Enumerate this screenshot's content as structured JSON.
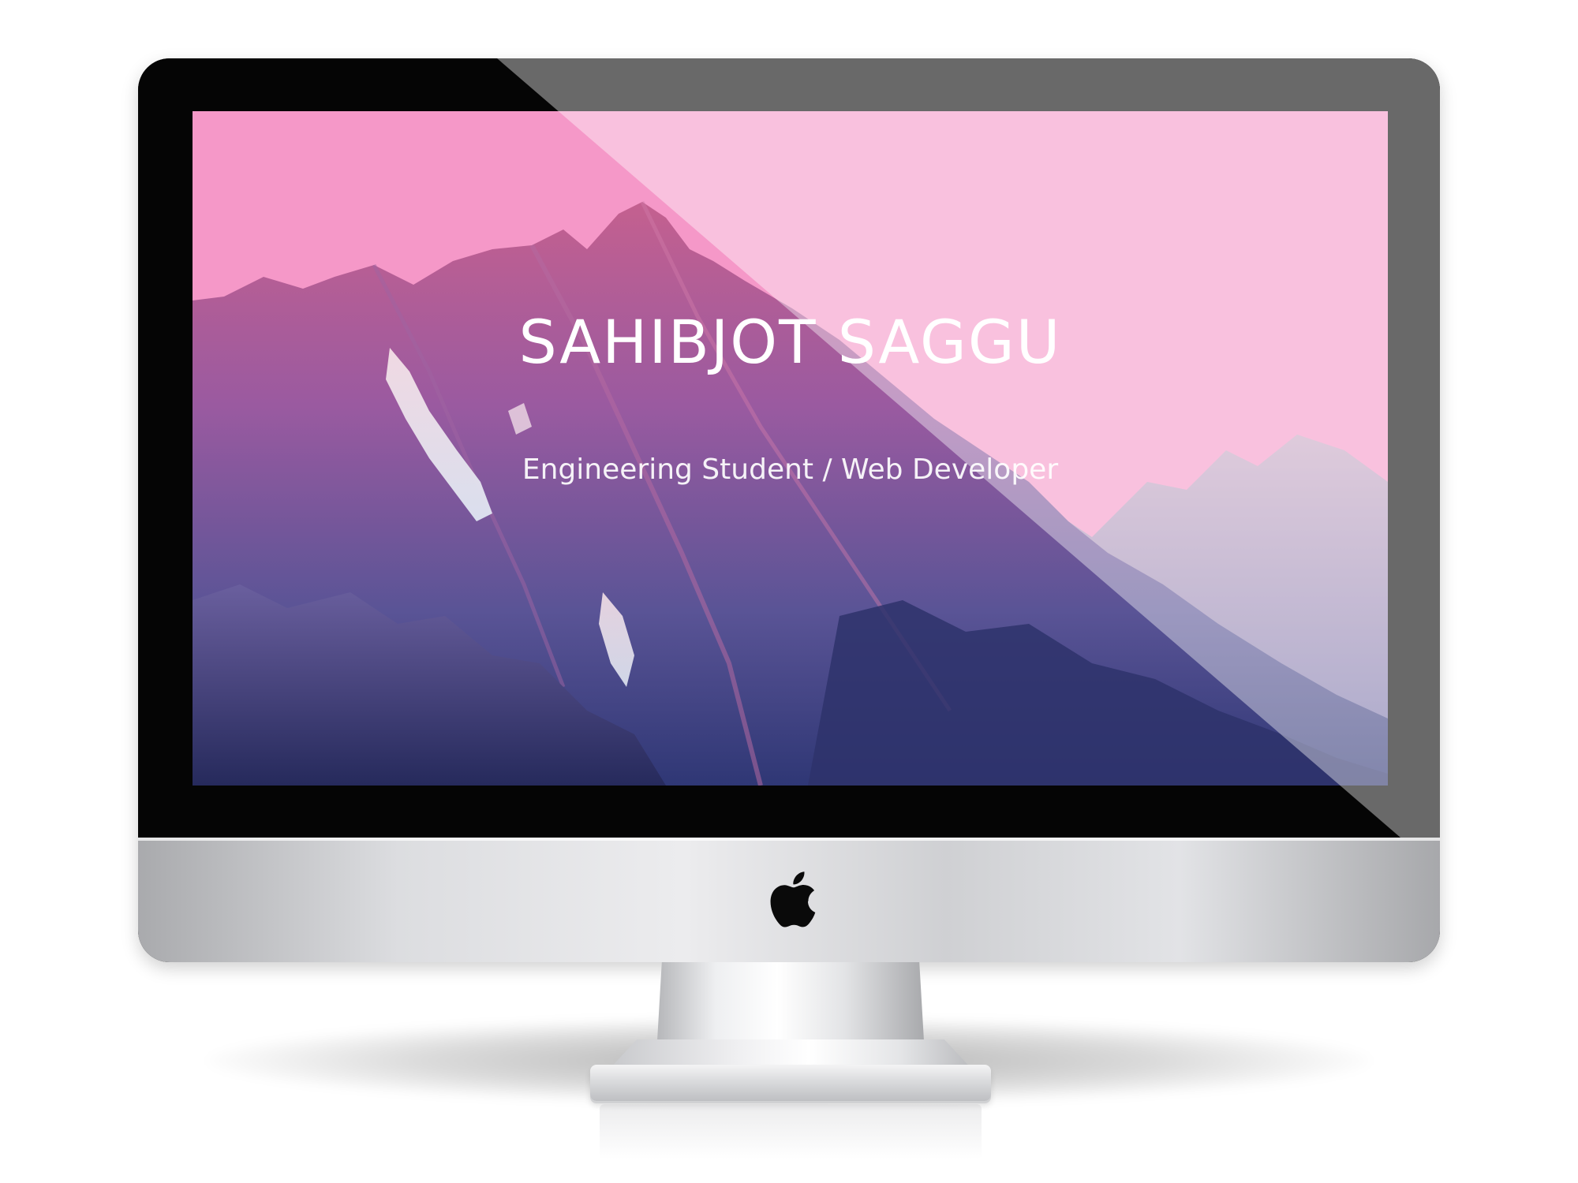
{
  "hero": {
    "title": "SAHIBJOT SAGGU",
    "subtitle": "Engineering Student / Web Developer"
  },
  "colors": {
    "sky_pink": "#f598c8",
    "bezel": "#050505",
    "glare_pink": "#f8bfdc",
    "mountain_dark": "#3b3f85",
    "mountain_mid": "#8a5aa6",
    "mountain_light": "#c46a9a",
    "aluminum": "#dcdde0"
  },
  "icons": {
    "brand_logo": "apple-logo-icon"
  }
}
